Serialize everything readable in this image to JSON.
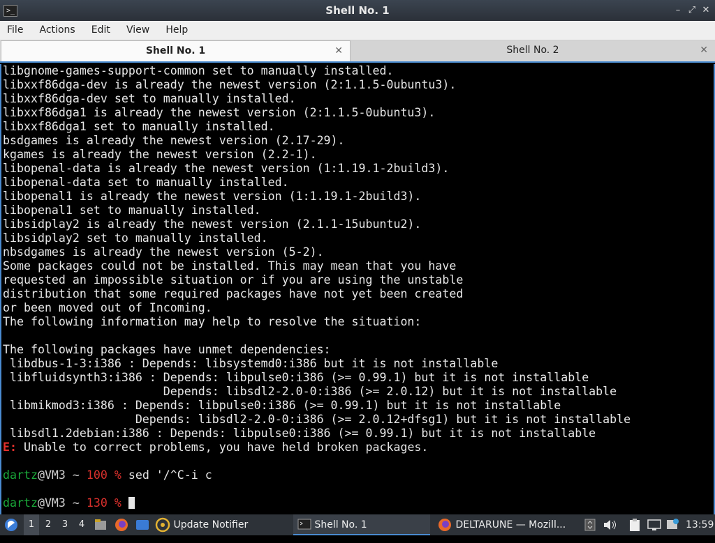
{
  "window": {
    "title": "Shell No. 1",
    "controls": {
      "minimize": "–",
      "maximize": "⤢",
      "close": "✕"
    }
  },
  "menu": [
    "File",
    "Actions",
    "Edit",
    "View",
    "Help"
  ],
  "tabs": [
    {
      "label": "Shell No. 1",
      "active": true
    },
    {
      "label": "Shell No. 2",
      "active": false
    }
  ],
  "terminal": {
    "output_lines": [
      "libgnome-games-support-common set to manually installed.",
      "libxxf86dga-dev is already the newest version (2:1.1.5-0ubuntu3).",
      "libxxf86dga-dev set to manually installed.",
      "libxxf86dga1 is already the newest version (2:1.1.5-0ubuntu3).",
      "libxxf86dga1 set to manually installed.",
      "bsdgames is already the newest version (2.17-29).",
      "kgames is already the newest version (2.2-1).",
      "libopenal-data is already the newest version (1:1.19.1-2build3).",
      "libopenal-data set to manually installed.",
      "libopenal1 is already the newest version (1:1.19.1-2build3).",
      "libopenal1 set to manually installed.",
      "libsidplay2 is already the newest version (2.1.1-15ubuntu2).",
      "libsidplay2 set to manually installed.",
      "nbsdgames is already the newest version (5-2).",
      "Some packages could not be installed. This may mean that you have",
      "requested an impossible situation or if you are using the unstable",
      "distribution that some required packages have not yet been created",
      "or been moved out of Incoming.",
      "The following information may help to resolve the situation:",
      "",
      "The following packages have unmet dependencies:",
      " libdbus-1-3:i386 : Depends: libsystemd0:i386 but it is not installable",
      " libfluidsynth3:i386 : Depends: libpulse0:i386 (>= 0.99.1) but it is not installable",
      "                       Depends: libsdl2-2.0-0:i386 (>= 2.0.12) but it is not installable",
      " libmikmod3:i386 : Depends: libpulse0:i386 (>= 0.99.1) but it is not installable",
      "                   Depends: libsdl2-2.0-0:i386 (>= 2.0.12+dfsg1) but it is not installable",
      " libsdl1.2debian:i386 : Depends: libpulse0:i386 (>= 0.99.1) but it is not installable"
    ],
    "error_prefix": "E:",
    "error_text": " Unable to correct problems, you have held broken packages.",
    "prompt1": {
      "user": "dartz",
      "host": "@VM3 ~ ",
      "code": "100 %",
      "command": " sed '/^C-i c"
    },
    "prompt2": {
      "user": "dartz",
      "host": "@VM3 ~ ",
      "code": "130 %",
      "command": " "
    }
  },
  "taskbar": {
    "workspaces": [
      "1",
      "2",
      "3",
      "4"
    ],
    "tasks": [
      {
        "label": "Update Notifier",
        "icon": "update-notifier-icon"
      },
      {
        "label": "Shell No. 1",
        "icon": "terminal-icon"
      },
      {
        "label": "DELTARUNE — Mozill...",
        "icon": "firefox-icon"
      }
    ],
    "clock": "13:59"
  }
}
